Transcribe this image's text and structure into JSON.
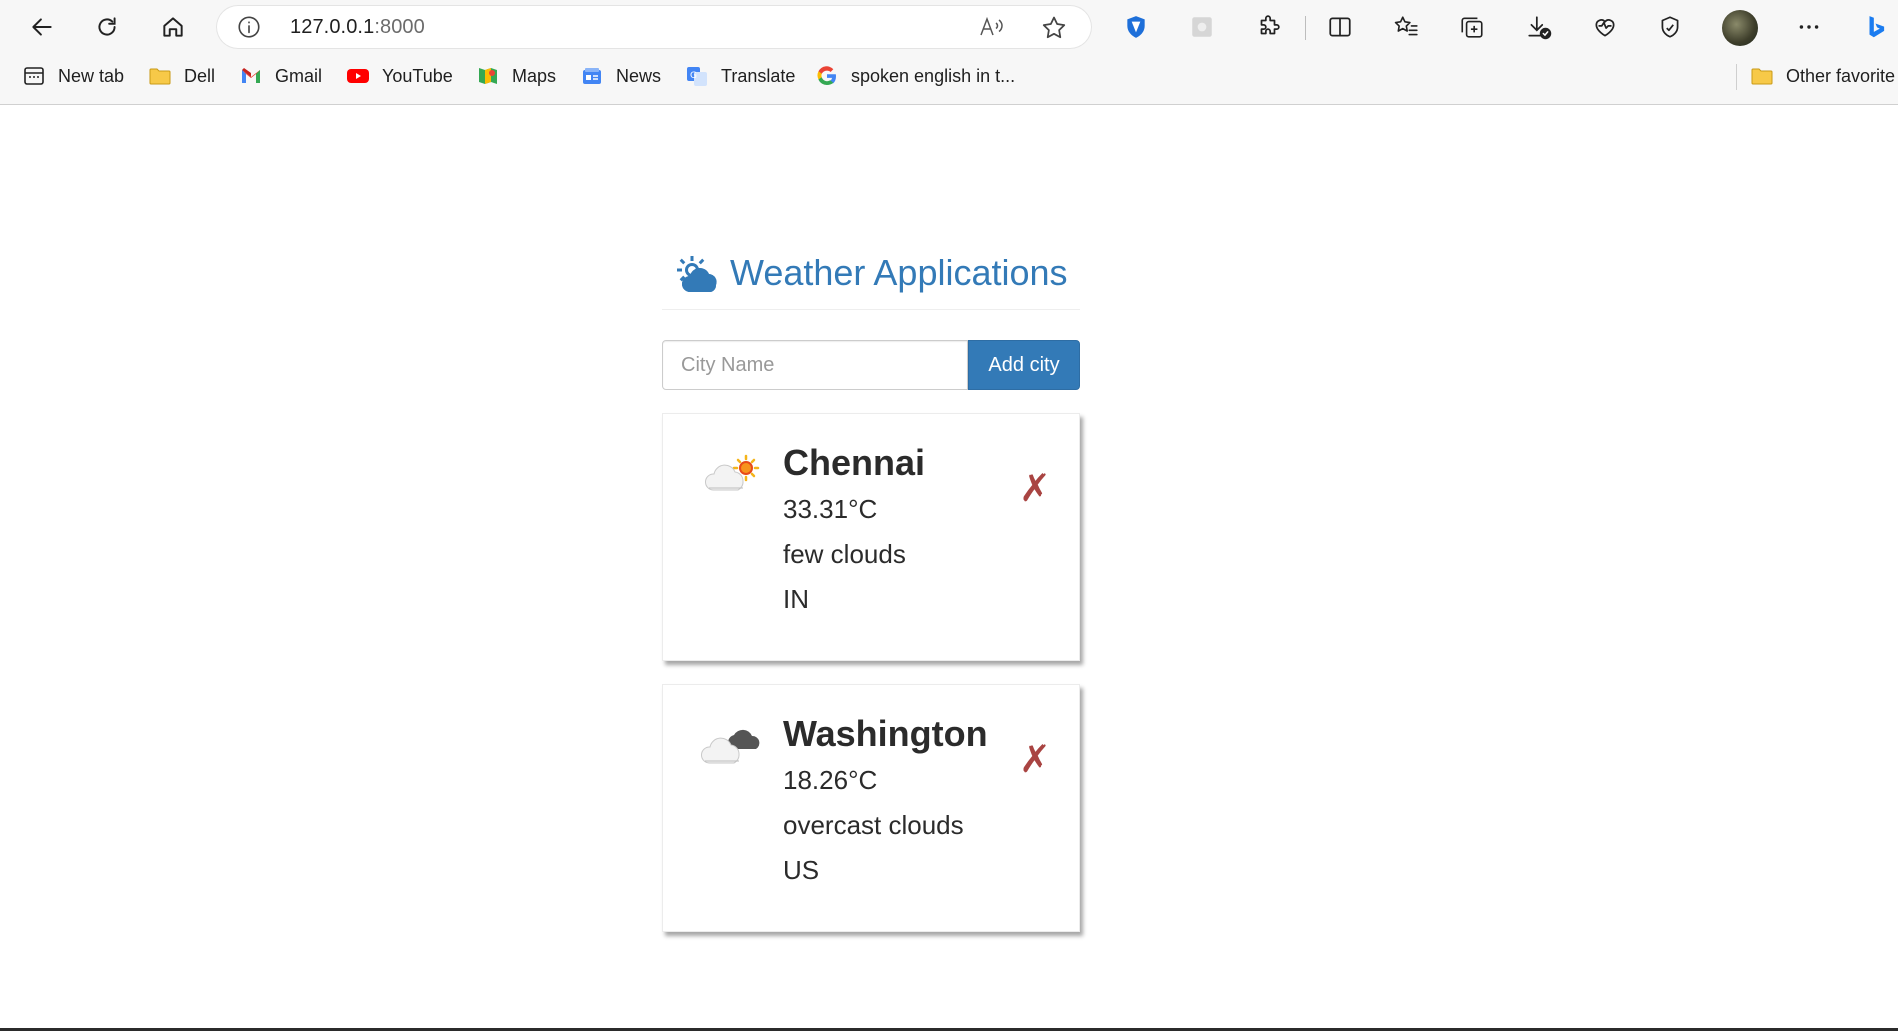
{
  "browser": {
    "url_host": "127.0.0.1",
    "url_port": ":8000",
    "bookmarks": [
      {
        "label": "New tab",
        "icon": "new-tab-icon"
      },
      {
        "label": "Dell",
        "icon": "folder-icon"
      },
      {
        "label": "Gmail",
        "icon": "gmail-icon"
      },
      {
        "label": "YouTube",
        "icon": "youtube-icon"
      },
      {
        "label": "Maps",
        "icon": "maps-icon"
      },
      {
        "label": "News",
        "icon": "news-icon"
      },
      {
        "label": "Translate",
        "icon": "translate-icon"
      },
      {
        "label": "spoken english in t...",
        "icon": "google-icon"
      }
    ],
    "other_favorites": "Other favorite"
  },
  "app": {
    "title": "Weather Applications",
    "accent_color": "#337ab7",
    "delete_color": "#a94442"
  },
  "form": {
    "placeholder": "City Name",
    "value": "",
    "button_label": "Add city"
  },
  "cities": [
    {
      "city": "Chennai",
      "temperature": "33.31°C",
      "description": "few clouds",
      "country": "IN",
      "icon": "few-clouds-icon",
      "delete": "✗"
    },
    {
      "city": "Washington",
      "temperature": "18.26°C",
      "description": "overcast clouds",
      "country": "US",
      "icon": "overcast-clouds-icon",
      "delete": "✗"
    }
  ]
}
